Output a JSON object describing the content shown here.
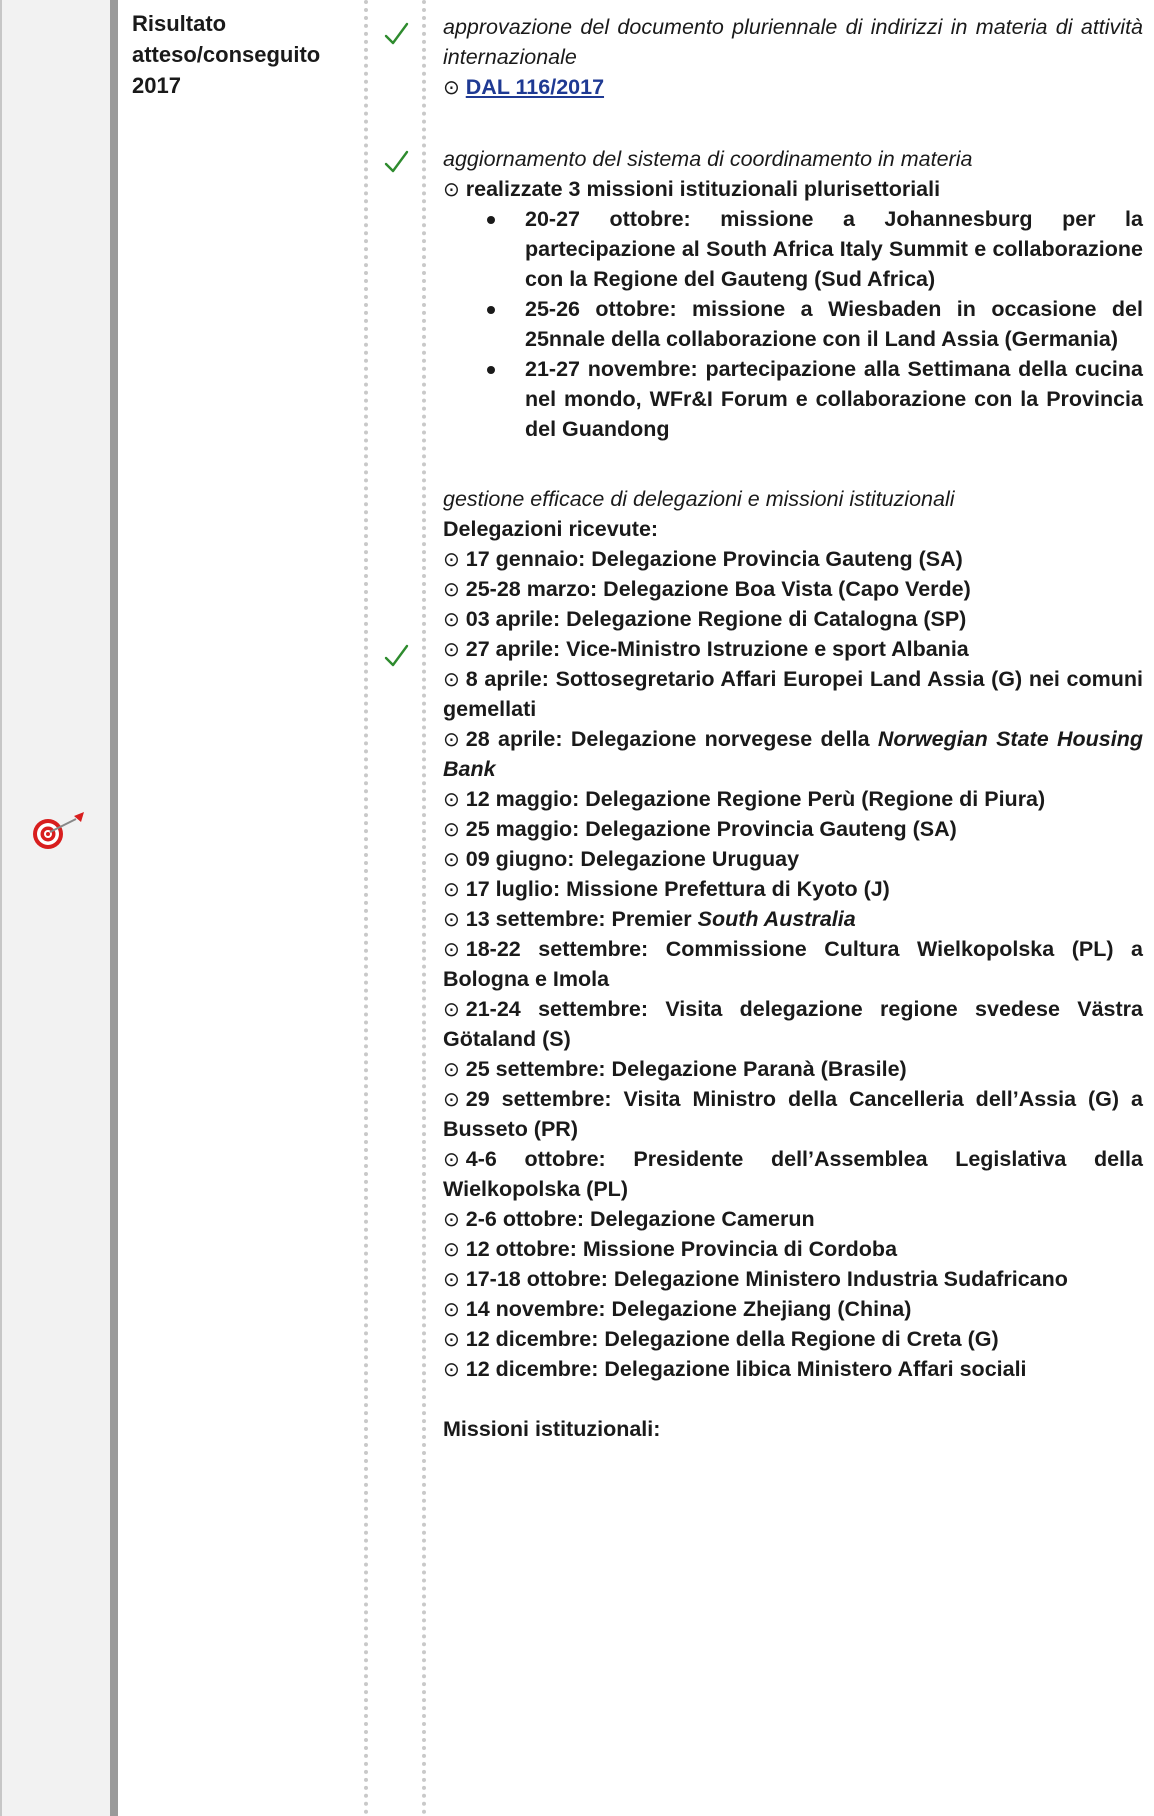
{
  "row_label": {
    "line1": "Risultato",
    "line2": "atteso/conseguito",
    "line3": "2017"
  },
  "icons": {
    "row_icon": "target-dart-icon",
    "check": "checkmark-icon",
    "bullet": "circled-dot-bullet"
  },
  "colors": {
    "check": "#2e8b2e",
    "link": "#1f3a93",
    "separator": "#9a9a9a",
    "icon_column": "#f2f2f2"
  },
  "bullet_glyph": "⊙",
  "items": [
    {
      "title": "approvazione del documento pluriennale di indirizzi in materia di attività internazionale",
      "link": "DAL 116/2017"
    },
    {
      "title": "aggiornamento del sistema di coordinamento in materia",
      "summary": "realizzate 3 missioni istituzionali plurisettoriali",
      "missions": [
        "20-27 ottobre: missione a Johannesburg per la partecipazione al South Africa Italy Summit e collaborazione con la Regione del Gauteng (Sud Africa)",
        "25-26 ottobre: missione a Wiesbaden in occasione del 25nnale della collaborazione con il Land Assia (Germania)",
        "21-27 novembre: partecipazione alla Settimana della cucina nel mondo, WFr&I Forum e collaborazione con la Provincia del Guandong"
      ]
    },
    {
      "title": "gestione efficace di delegazioni e missioni istituzionali",
      "delegations_heading": "Delegazioni ricevute:",
      "delegations": [
        "17 gennaio: Delegazione Provincia Gauteng (SA)",
        "25-28 marzo: Delegazione Boa Vista (Capo Verde)",
        "03 aprile: Delegazione Regione di Catalogna (SP)",
        "27 aprile: Vice-Ministro Istruzione e sport Albania",
        "8 aprile: Sottosegretario Affari Europei Land Assia (G) nei comuni gemellati",
        "28 aprile: Delegazione norvegese della ",
        "12 maggio: Delegazione Regione Perù (Regione di Piura)",
        "25 maggio: Delegazione Provincia Gauteng (SA)",
        "09 giugno: Delegazione Uruguay",
        "17 luglio: Missione Prefettura di Kyoto (J)",
        "13 settembre: Premier ",
        "18-22 settembre: Commissione Cultura Wielkopolska (PL) a Bologna e Imola",
        "21-24 settembre: Visita delegazione regione svedese Västra Götaland (S)",
        "25 settembre: Delegazione Paranà (Brasile)",
        "29 settembre: Visita Ministro della Cancelleria dell’Assia (G) a Busseto (PR)",
        "4-6 ottobre: Presidente dell’Assemblea Legislativa della Wielkopolska (PL)",
        "2-6 ottobre: Delegazione Camerun",
        "12 ottobre: Missione Provincia di Cordoba",
        "17-18 ottobre: Delegazione Ministero Industria Sudafricano",
        "14 novembre: Delegazione Zhejiang (China)",
        "12 dicembre: Delegazione della Regione di Creta (G)",
        "12 dicembre: Delegazione libica Ministero Affari sociali"
      ],
      "delegation_italics": {
        "d5": "Norwegian State Housing Bank",
        "d10": "South Australia"
      },
      "missions_heading": "Missioni istituzionali:"
    }
  ]
}
